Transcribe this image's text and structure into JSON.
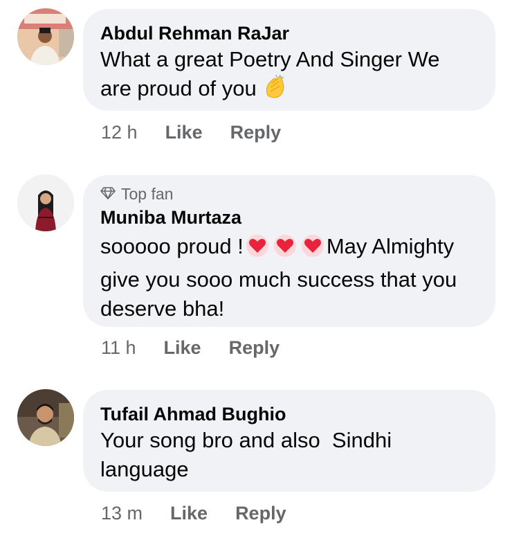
{
  "comments": [
    {
      "author": "Abdul Rehman RaJar",
      "text_line1": "What a great Poetry And Singer We",
      "text_line2": "are proud of you",
      "time": "12 h",
      "like": "Like",
      "reply": "Reply",
      "emoji": "clapping-hands-icon"
    },
    {
      "badge": "Top fan",
      "author": "Muniba Murtaza",
      "text_part1": "sooooo proud !",
      "text_part2": "May Almighty",
      "text_line2": "give you sooo much success that you",
      "text_line3": "deserve bha!",
      "time": "11 h",
      "like": "Like",
      "reply": "Reply",
      "emoji": "heart-icon"
    },
    {
      "author": "Tufail Ahmad Bughio",
      "text_line1": "Your song bro and also  Sindhi",
      "text_line2": "language",
      "time": "13 m",
      "like": "Like",
      "reply": "Reply"
    }
  ],
  "colors": {
    "bubble": "#f0f2f5",
    "meta": "#65676b",
    "text": "#050505"
  }
}
